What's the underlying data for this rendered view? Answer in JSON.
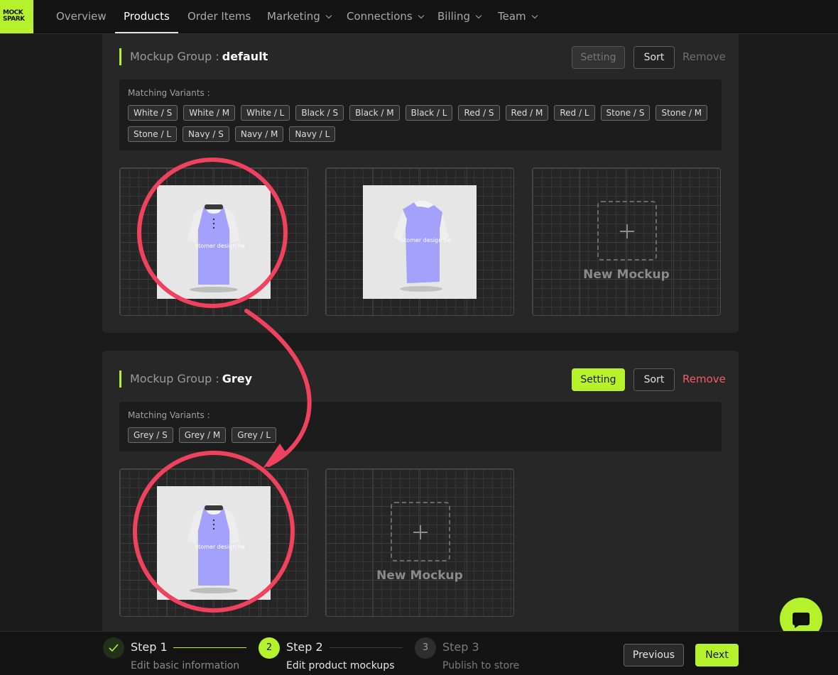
{
  "logo": {
    "line1": "MOCK",
    "line2": "SPARK"
  },
  "nav": {
    "items": [
      {
        "label": "Overview"
      },
      {
        "label": "Products"
      },
      {
        "label": "Order Items"
      },
      {
        "label": "Marketing"
      },
      {
        "label": "Connections"
      },
      {
        "label": "Billing"
      },
      {
        "label": "Team"
      }
    ],
    "active": "Products"
  },
  "groups": [
    {
      "title_prefix": "Mockup Group :",
      "name": "default",
      "setting_label": "Setting",
      "sort_label": "Sort",
      "remove_label": "Remove",
      "variants_label": "Matching Variants :",
      "variants": [
        "White / S",
        "White / M",
        "White / L",
        "Black / S",
        "Black / M",
        "Black / L",
        "Red / S",
        "Red / M",
        "Red / L",
        "Stone / S",
        "Stone / M",
        "Stone / L",
        "Navy / S",
        "Navy / M",
        "Navy / L"
      ],
      "mockup_image_text": "stomer design he",
      "new_mockup_label": "New Mockup"
    },
    {
      "title_prefix": "Mockup Group :",
      "name": "Grey",
      "setting_label": "Setting",
      "sort_label": "Sort",
      "remove_label": "Remove",
      "variants_label": "Matching Variants :",
      "variants": [
        "Grey / S",
        "Grey / M",
        "Grey / L"
      ],
      "mockup_image_text": "stomer design he",
      "new_mockup_label": "New Mockup"
    }
  ],
  "steps": [
    {
      "number": "1",
      "title": "Step 1",
      "desc": "Edit basic information",
      "state": "done"
    },
    {
      "number": "2",
      "title": "Step 2",
      "desc": "Edit product mockups",
      "state": "active"
    },
    {
      "number": "3",
      "title": "Step 3",
      "desc": "Publish to store",
      "state": "pending"
    }
  ],
  "footer": {
    "previous_label": "Previous",
    "next_label": "Next"
  },
  "colors": {
    "accent": "#b6f22c",
    "annotation": "#f0415f",
    "remove_red": "#f25c6a",
    "shirt": "#a3a1fb"
  }
}
